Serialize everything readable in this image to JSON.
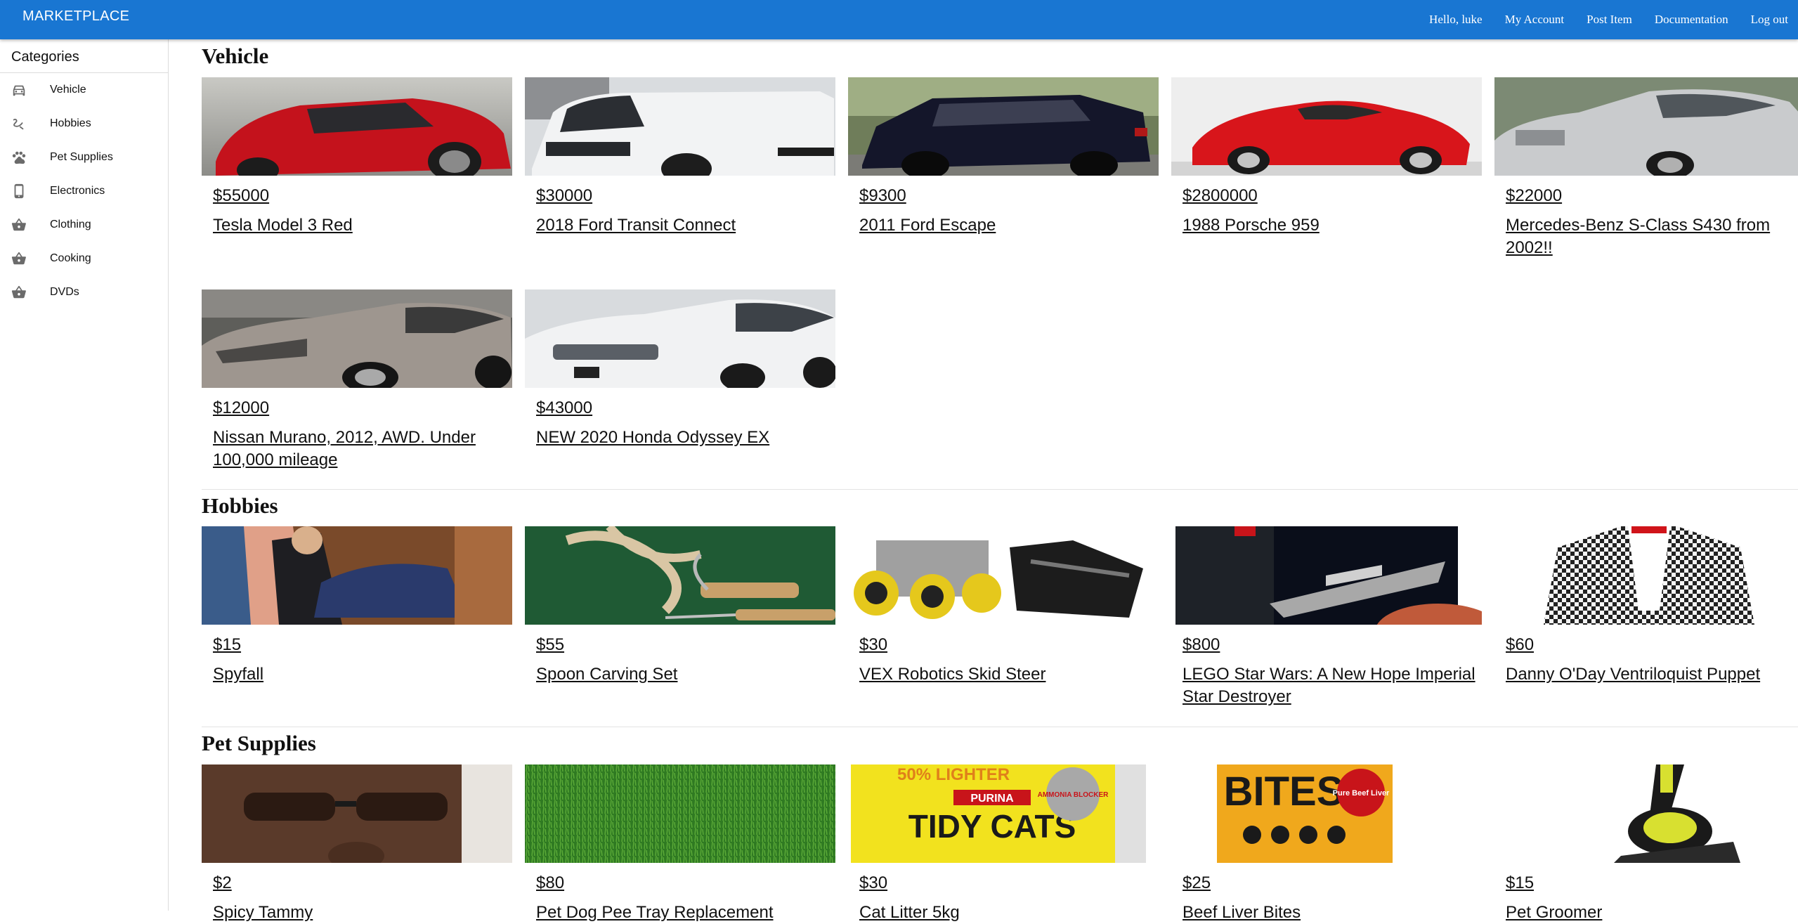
{
  "app": {
    "brand": "MARKETPLACE",
    "nav": {
      "greeting": "Hello, luke",
      "my_account": "My Account",
      "post_item": "Post Item",
      "documentation": "Documentation",
      "logout": "Log out"
    }
  },
  "sidebar": {
    "title": "Categories",
    "items": [
      {
        "label": "Vehicle",
        "icon": "car-icon"
      },
      {
        "label": "Hobbies",
        "icon": "hobbies-icon"
      },
      {
        "label": "Pet Supplies",
        "icon": "paw-icon"
      },
      {
        "label": "Electronics",
        "icon": "phone-icon"
      },
      {
        "label": "Clothing",
        "icon": "basket-icon"
      },
      {
        "label": "Cooking",
        "icon": "basket-icon"
      },
      {
        "label": "DVDs",
        "icon": "basket-icon"
      }
    ]
  },
  "sections": [
    {
      "title": "Vehicle",
      "listings": [
        {
          "price": "$55000",
          "title": "Tesla Model 3 Red"
        },
        {
          "price": "$30000",
          "title": "2018 Ford Transit Connect"
        },
        {
          "price": "$9300",
          "title": "2011 Ford Escape"
        },
        {
          "price": "$2800000",
          "title": "1988 Porsche 959"
        },
        {
          "price": "$22000",
          "title": "Mercedes-Benz S-Class S430 from 2002!!"
        },
        {
          "price": "$12000",
          "title": "Nissan Murano, 2012, AWD. Under 100,000 mileage"
        },
        {
          "price": "$43000",
          "title": "NEW 2020 Honda Odyssey EX"
        }
      ]
    },
    {
      "title": "Hobbies",
      "listings": [
        {
          "price": "$15",
          "title": "Spyfall"
        },
        {
          "price": "$55",
          "title": "Spoon Carving Set"
        },
        {
          "price": "$30",
          "title": "VEX Robotics Skid Steer"
        },
        {
          "price": "$800",
          "title": "LEGO Star Wars: A New Hope Imperial Star Destroyer"
        },
        {
          "price": "$60",
          "title": "Danny O'Day Ventriloquist Puppet"
        }
      ]
    },
    {
      "title": "Pet Supplies",
      "listings": [
        {
          "price": "$2",
          "title": "Spicy Tammy"
        },
        {
          "price": "$80",
          "title": "Pet Dog Pee Tray Replacement"
        },
        {
          "price": "$30",
          "title": "Cat Litter 5kg"
        },
        {
          "price": "$25",
          "title": "Beef Liver Bites"
        },
        {
          "price": "$15",
          "title": "Pet Groomer"
        }
      ]
    }
  ],
  "images": {
    "tidy_cats_top": "50% LIGHTER",
    "tidy_cats_brand": "PURINA",
    "tidy_cats_name": "TIDY CATS",
    "tidy_cats_badge": "AMMONIA BLOCKER",
    "bites_brand": "BITES",
    "bites_badge": "Pure Beef Liver"
  },
  "colors": {
    "appbar": "#1976d2",
    "text": "#111111",
    "divider": "#dcdcdc"
  }
}
